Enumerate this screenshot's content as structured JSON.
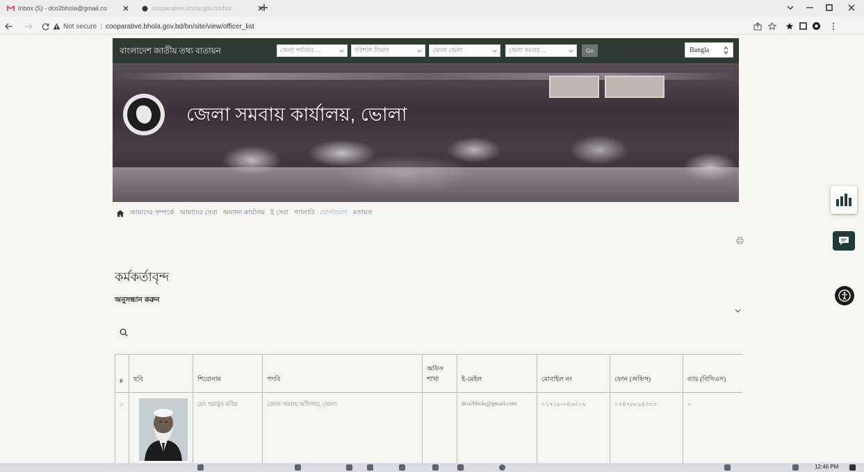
{
  "browser": {
    "tabs": [
      {
        "label": "Inbox (5) - dco2bhola@gmail.co",
        "icon": "gmail-icon"
      },
      {
        "label": "cooparative.bhola.gov.bd/bn/",
        "icon": "site-favicon"
      }
    ],
    "address_bar": {
      "security_label": "Not secure",
      "separator": "|",
      "url": "cooparative.bhola.gov.bd/bn/site/view/officer_list"
    },
    "toolbar_icons": [
      "share-icon",
      "bookmark-star-icon",
      "pin-icon",
      "sidebar-icon",
      "extension-icon",
      "menu-icon"
    ],
    "window_controls": [
      "tab-search-icon",
      "minimize-icon",
      "maximize-icon",
      "close-icon"
    ]
  },
  "site": {
    "header": {
      "portal_label": "বাংলাদেশ জাতীয় তথ্য বাতায়ন",
      "selectors": [
        {
          "value": "জেলা পর্যায়ের ..."
        },
        {
          "value": "বরিশাল বিভাগ"
        },
        {
          "value": "ভোলা জেলা"
        },
        {
          "value": "জেলা সমবায় ..."
        }
      ],
      "go_label": "Go",
      "language": "Bangla"
    },
    "banner": {
      "title": "জেলা সমবায় কার্যালয়, ভোলা"
    },
    "menu": [
      "আমাদের সম্পর্কে",
      "আমাদের সেবা",
      "অন্যান্য কার্যালয়",
      "ই সেবা",
      "গ্যালারি",
      "যোগাযোগ",
      "মতামত"
    ],
    "page_title": "কর্মকর্তাবৃন্দ",
    "search_heading": "অনুসন্ধান করুন",
    "table": {
      "headers": [
        "#",
        "ছবি",
        "শিরোনাম",
        "পদবি",
        "অফিস শাখা",
        "ই-মেইল",
        "মোবাইল নং",
        "ফোন (অফিস)",
        "ব্যাচ (বিসিএস)"
      ],
      "rows": [
        {
          "serial": "১",
          "name": "মো: হুমায়ূন কবির",
          "designation": "জেলা সমবায় অফিসার, ভোলা",
          "email": "dco2bhola@gmail.com",
          "mobile": "০১৭১৮-০৪৬৩১৬",
          "phone": "০২৪৭৮৮৯৪৩৭৩",
          "batch": "০"
        }
      ]
    }
  },
  "taskbar": {
    "clock": "12:46 PM"
  },
  "colors": {
    "site_header_bg": "#2f3a34",
    "link": "#7e8fa6",
    "page_bg": "#f6f5f2"
  }
}
